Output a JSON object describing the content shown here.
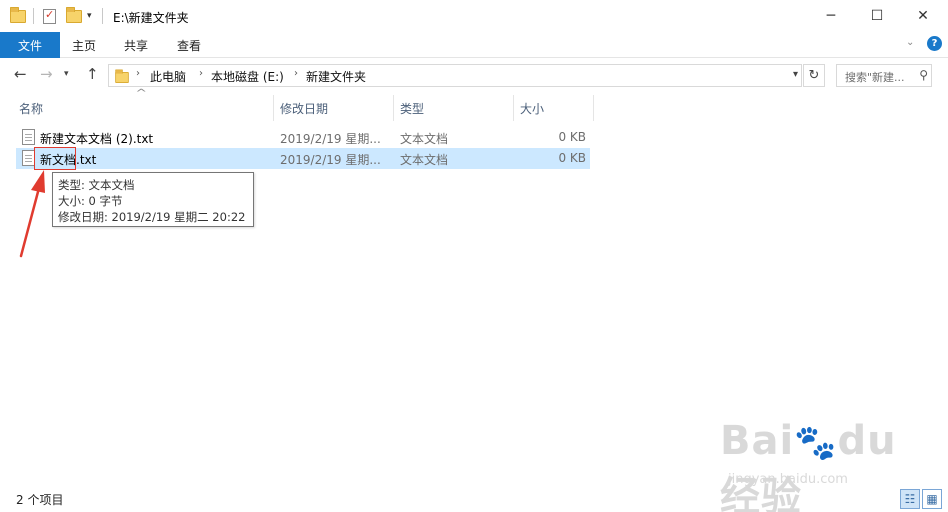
{
  "window": {
    "title": "E:\\新建文件夹",
    "controls": [
      "minimize-icon",
      "maximize-icon",
      "close-icon"
    ]
  },
  "ribbon": {
    "tabs": [
      {
        "label": "文件",
        "active": true
      },
      {
        "label": "主页"
      },
      {
        "label": "共享"
      },
      {
        "label": "查看"
      }
    ]
  },
  "address": {
    "crumbs": [
      "此电脑",
      "本地磁盘 (E:)",
      "新建文件夹"
    ]
  },
  "search": {
    "placeholder": "搜索\"新建..."
  },
  "columns": {
    "name": "名称",
    "modified": "修改日期",
    "type": "类型",
    "size": "大小"
  },
  "files": [
    {
      "name": "新建文本文档 (2).txt",
      "modified": "2019/2/19 星期...",
      "type": "文本文档",
      "size": "0 KB",
      "selected": false
    },
    {
      "name": "新文档.txt",
      "modified": "2019/2/19 星期...",
      "type": "文本文档",
      "size": "0 KB",
      "selected": true
    }
  ],
  "tooltip": {
    "type_line": "类型: 文本文档",
    "size_line": "大小: 0 字节",
    "modified_line": "修改日期: 2019/2/19 星期二 20:22"
  },
  "status": {
    "item_count": "2 个项目"
  },
  "watermark": {
    "brand": "Bai经验",
    "url": "jingyan.baidu.com"
  },
  "colors": {
    "accent": "#1979ca",
    "selection": "#cce8ff",
    "annotation": "#e03b2f"
  }
}
